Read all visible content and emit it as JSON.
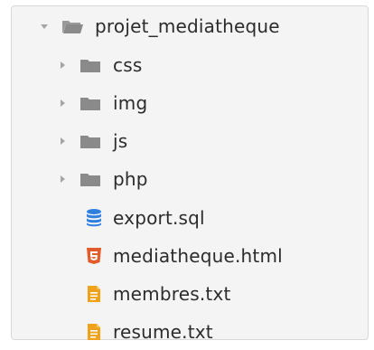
{
  "explorer": {
    "root": {
      "name": "projet_mediatheque",
      "expanded": true,
      "icon": "folder-open-icon"
    },
    "items": [
      {
        "name": "css",
        "type": "folder",
        "icon": "folder-icon"
      },
      {
        "name": "img",
        "type": "folder",
        "icon": "folder-icon"
      },
      {
        "name": "js",
        "type": "folder",
        "icon": "folder-icon"
      },
      {
        "name": "php",
        "type": "folder",
        "icon": "folder-icon"
      },
      {
        "name": "export.sql",
        "type": "file",
        "icon": "database-icon"
      },
      {
        "name": "mediatheque.html",
        "type": "file",
        "icon": "html5-icon"
      },
      {
        "name": "membres.txt",
        "type": "file",
        "icon": "text-file-icon"
      },
      {
        "name": "resume.txt",
        "type": "file",
        "icon": "text-file-icon"
      }
    ]
  },
  "colors": {
    "panel_bg": "#f4f4f4",
    "text": "#2b2b2b",
    "folder_gray": "#8a8a8a",
    "chevron_gray": "#a5a5a5",
    "database_blue": "#2d7fe0",
    "html5_orange": "#e35b2a",
    "text_file_orange": "#f0a21a"
  }
}
